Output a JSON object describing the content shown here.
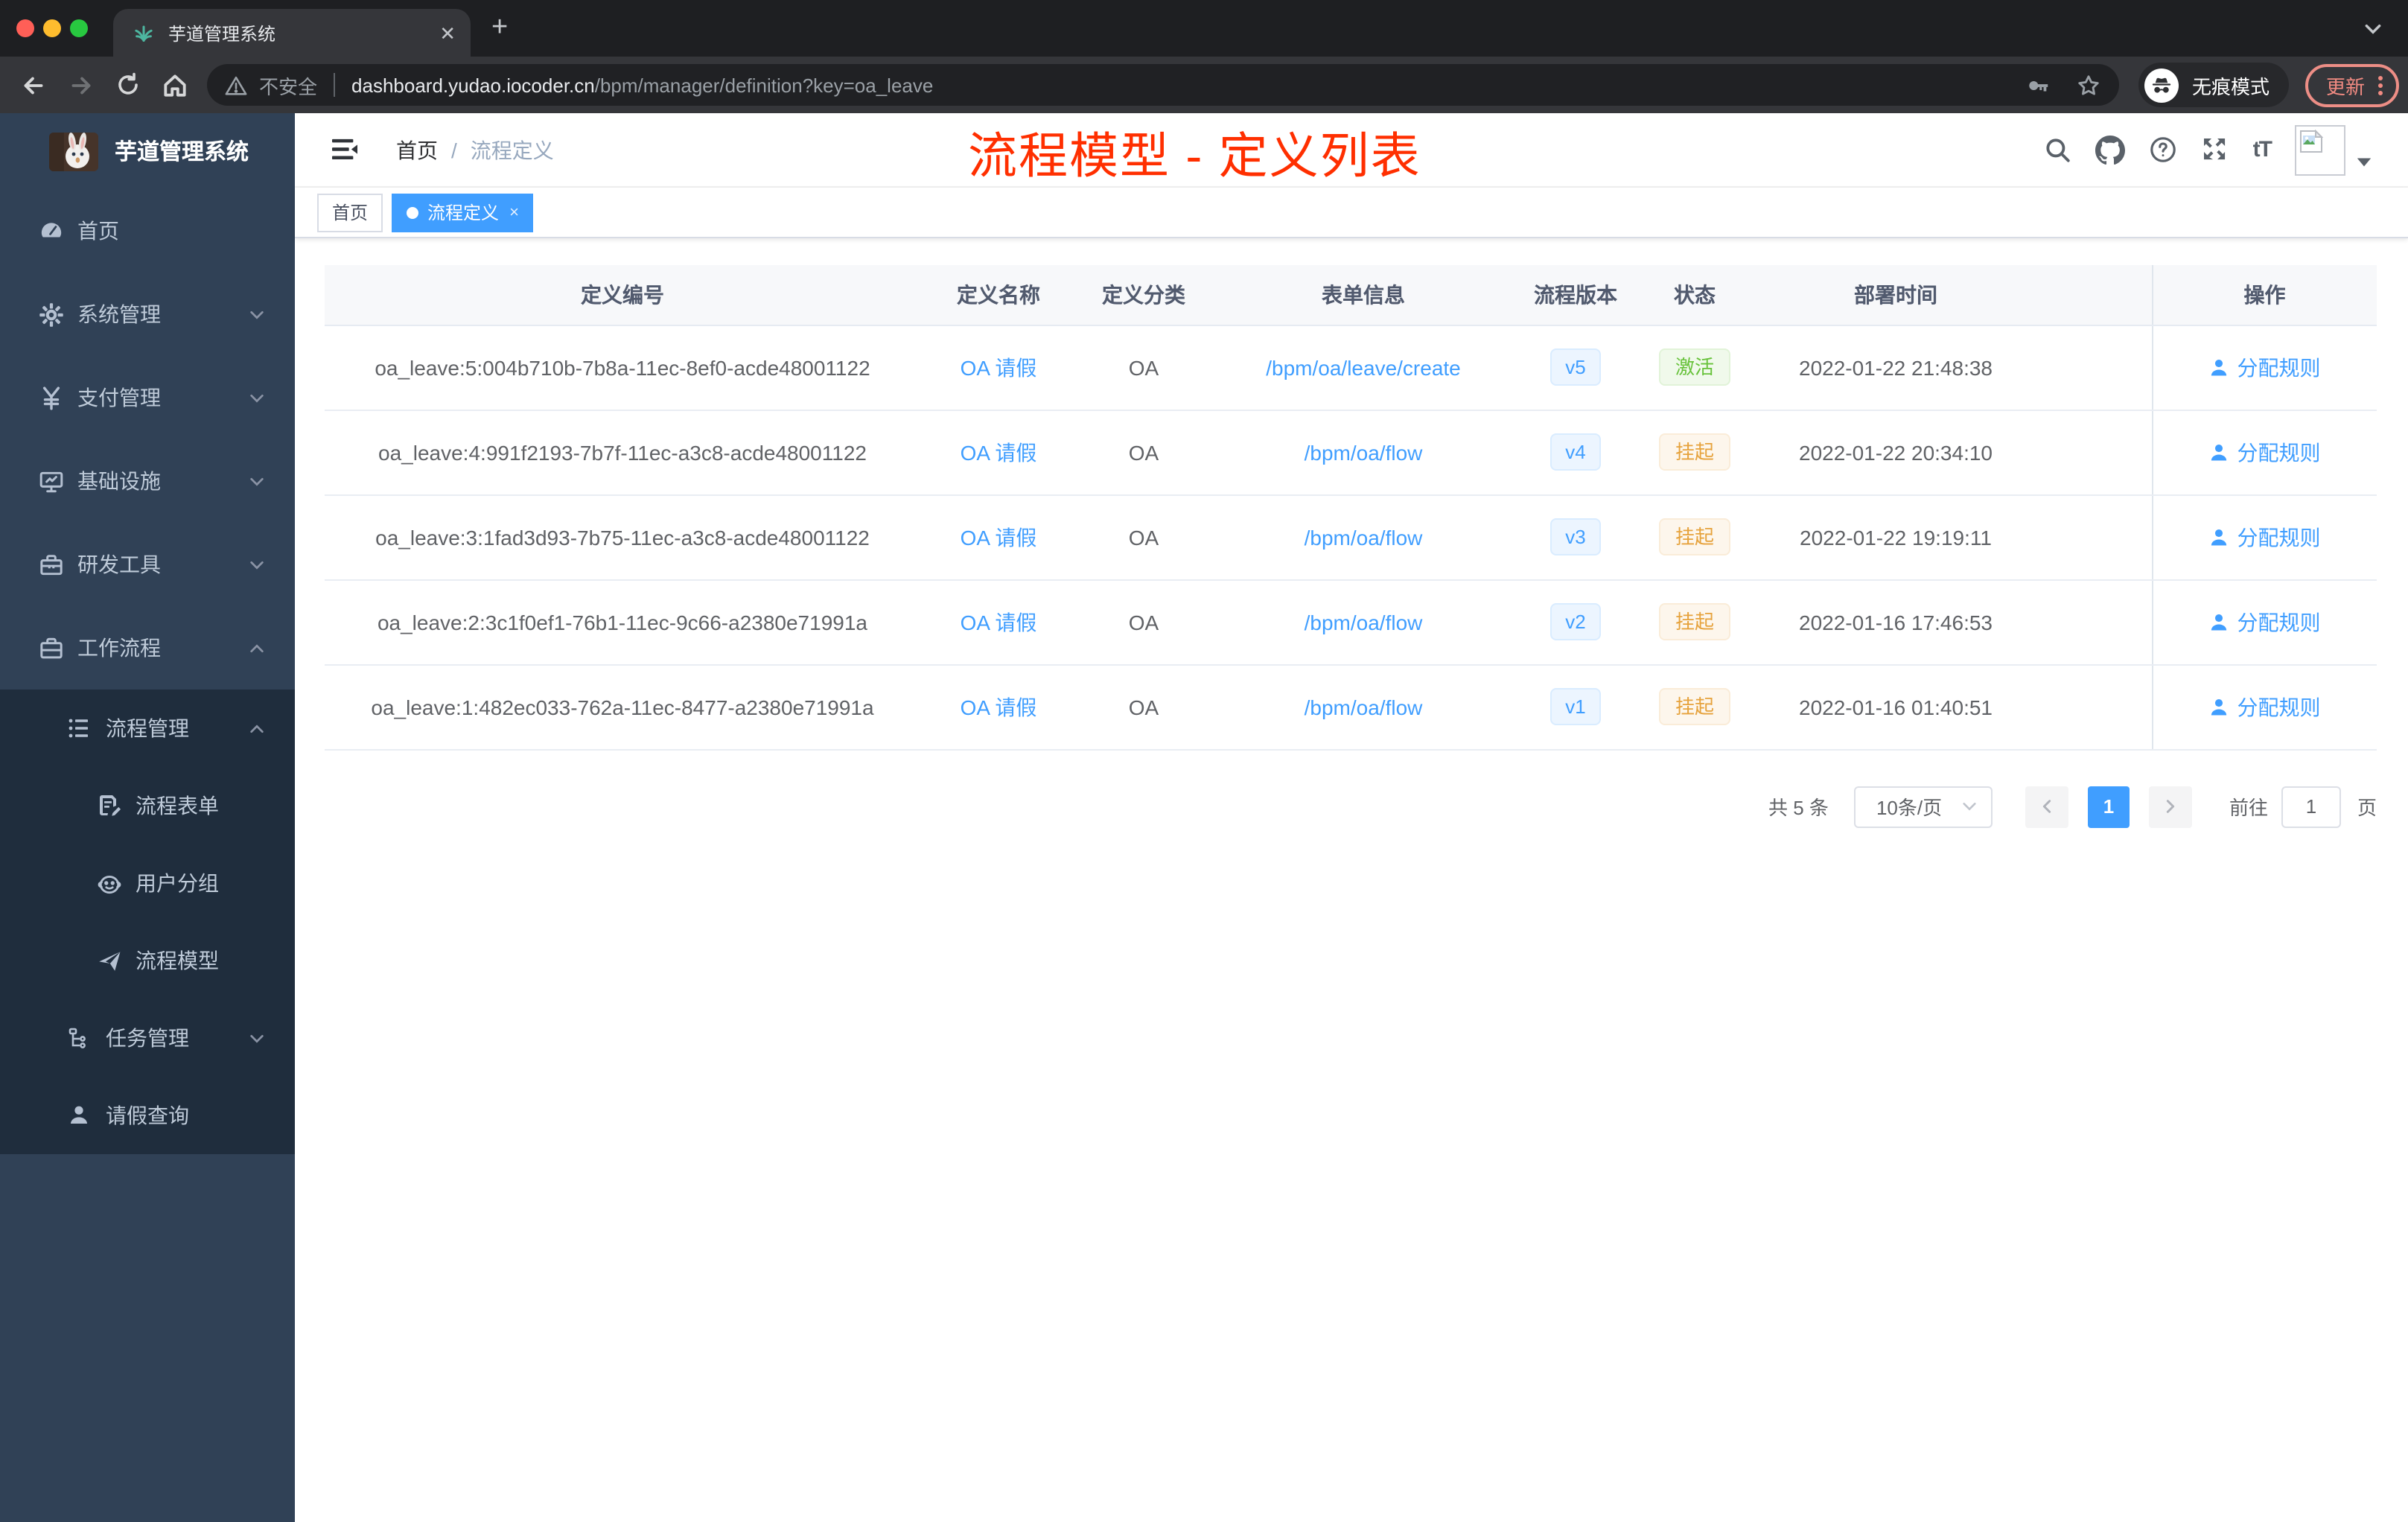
{
  "browser": {
    "tab_title": "芋道管理系统",
    "close_tab": "✕",
    "new_tab": "+",
    "security_label": "不安全",
    "url_host": "dashboard.yudao.iocoder.cn",
    "url_path": "/bpm/manager/definition?key=oa_leave",
    "incognito_label": "无痕模式",
    "update_label": "更新"
  },
  "sidebar": {
    "title": "芋道管理系统",
    "items": [
      {
        "label": "首页",
        "icon": "dashboard-icon",
        "expandable": false
      },
      {
        "label": "系统管理",
        "icon": "gear-icon",
        "expandable": true,
        "expanded": false
      },
      {
        "label": "支付管理",
        "icon": "yen-icon",
        "expandable": true,
        "expanded": false
      },
      {
        "label": "基础设施",
        "icon": "monitor-icon",
        "expandable": true,
        "expanded": false
      },
      {
        "label": "研发工具",
        "icon": "toolbox-icon",
        "expandable": true,
        "expanded": false
      },
      {
        "label": "工作流程",
        "icon": "suitcase-icon",
        "expandable": true,
        "expanded": true
      },
      {
        "label": "流程管理",
        "icon": "tree-list-icon",
        "expandable": true,
        "expanded": true
      },
      {
        "label": "流程表单",
        "icon": "form-edit-icon"
      },
      {
        "label": "用户分组",
        "icon": "robot-icon"
      },
      {
        "label": "流程模型",
        "icon": "send-icon"
      },
      {
        "label": "任务管理",
        "icon": "org-tree-icon",
        "expandable": true,
        "expanded": false
      },
      {
        "label": "请假查询",
        "icon": "user-icon"
      }
    ]
  },
  "header": {
    "breadcrumb_home": "首页",
    "breadcrumb_sep": "/",
    "breadcrumb_current": "流程定义",
    "annotation": "流程模型 - 定义列表",
    "font_size_icon_label": "tT"
  },
  "tags": [
    {
      "label": "首页",
      "active": false
    },
    {
      "label": "流程定义",
      "active": true,
      "close": "×"
    }
  ],
  "table": {
    "columns": [
      "定义编号",
      "定义名称",
      "定义分类",
      "表单信息",
      "流程版本",
      "状态",
      "部署时间",
      "操作"
    ],
    "rows": [
      {
        "id": "oa_leave:5:004b710b-7b8a-11ec-8ef0-acde48001122",
        "name": "OA 请假",
        "category": "OA",
        "form": "/bpm/oa/leave/create",
        "version": "v5",
        "status": "激活",
        "status_type": "success",
        "time": "2022-01-22 21:48:38",
        "action": "分配规则"
      },
      {
        "id": "oa_leave:4:991f2193-7b7f-11ec-a3c8-acde48001122",
        "name": "OA 请假",
        "category": "OA",
        "form": "/bpm/oa/flow",
        "version": "v4",
        "status": "挂起",
        "status_type": "warning",
        "time": "2022-01-22 20:34:10",
        "action": "分配规则"
      },
      {
        "id": "oa_leave:3:1fad3d93-7b75-11ec-a3c8-acde48001122",
        "name": "OA 请假",
        "category": "OA",
        "form": "/bpm/oa/flow",
        "version": "v3",
        "status": "挂起",
        "status_type": "warning",
        "time": "2022-01-22 19:19:11",
        "action": "分配规则"
      },
      {
        "id": "oa_leave:2:3c1f0ef1-76b1-11ec-9c66-a2380e71991a",
        "name": "OA 请假",
        "category": "OA",
        "form": "/bpm/oa/flow",
        "version": "v2",
        "status": "挂起",
        "status_type": "warning",
        "time": "2022-01-16 17:46:53",
        "action": "分配规则"
      },
      {
        "id": "oa_leave:1:482ec033-762a-11ec-8477-a2380e71991a",
        "name": "OA 请假",
        "category": "OA",
        "form": "/bpm/oa/flow",
        "version": "v1",
        "status": "挂起",
        "status_type": "warning",
        "time": "2022-01-16 01:40:51",
        "action": "分配规则"
      }
    ]
  },
  "pagination": {
    "total": "共 5 条",
    "page_size": "10条/页",
    "current_page": "1",
    "goto_label": "前往",
    "goto_value": "1",
    "page_unit": "页"
  },
  "colors": {
    "accent": "#409eff",
    "annotation_red": "#ff2f00",
    "sidebar_bg": "#304156",
    "submenu_bg": "#1f2d3d",
    "status_active_green": "#67c23a",
    "status_suspend_orange": "#e6a23c"
  }
}
